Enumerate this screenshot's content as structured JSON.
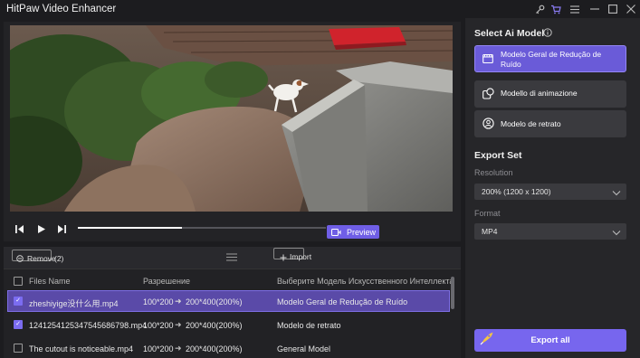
{
  "app": {
    "title": "HitPaw Video Enhancer",
    "accent": "#7766ee"
  },
  "titlebar_icons": [
    "key-icon",
    "cart-icon",
    "menu-icon",
    "minimize-icon",
    "maximize-icon",
    "close-icon"
  ],
  "player": {
    "progress": 0.42,
    "preview_label": "Preview"
  },
  "list_toolbar": {
    "remove_label": "Remove",
    "remove_count": "(2)",
    "import_label": "Import"
  },
  "table": {
    "headers": [
      "Files Name",
      "Разрешение",
      "Выберите Модель Искусственного Интеллекта"
    ],
    "rows": [
      {
        "checked": true,
        "selected": true,
        "name": "zheshiyige没什么用.mp4",
        "res_from": "100*200",
        "res_to": "200*400(200%)",
        "model": "Modelo Geral de Redução de Ruído"
      },
      {
        "checked": true,
        "selected": false,
        "name": "124125412534754568679​8.mp4",
        "res_from": "100*200",
        "res_to": "200*400(200%)",
        "model": "Modelo de retrato"
      },
      {
        "checked": false,
        "selected": false,
        "name": "The cutout is noticeable.mp4",
        "res_from": "100*200",
        "res_to": "200*400(200%)",
        "model": "General Model"
      }
    ]
  },
  "sidebar": {
    "select_model_title": "Select Ai Model",
    "models": [
      {
        "label": "Modelo Geral de Redução de Ruído",
        "selected": true,
        "icon": "film-icon"
      },
      {
        "label": "Modello di animazione",
        "selected": false,
        "icon": "animation-icon"
      },
      {
        "label": "Modelo de retrato",
        "selected": false,
        "icon": "portrait-icon"
      }
    ],
    "export_set_title": "Export Set",
    "resolution_label": "Resolution",
    "resolution_value": "200% (1200 x 1200)",
    "format_label": "Format",
    "format_value": "MP4",
    "export_label": "Export all"
  }
}
